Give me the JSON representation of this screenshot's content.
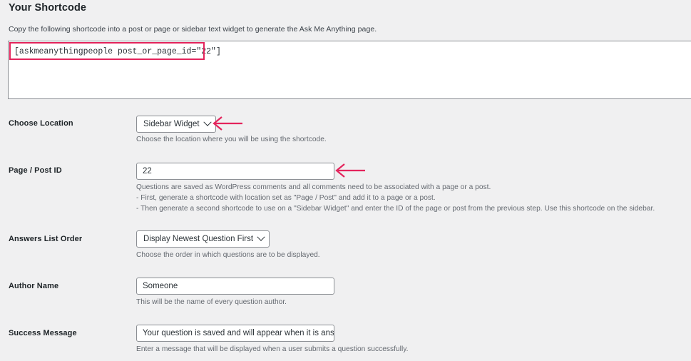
{
  "header": {
    "title": "Your Shortcode",
    "description": "Copy the following shortcode into a post or page or sidebar text widget to generate the Ask Me Anything page."
  },
  "shortcode": {
    "value": "[askmeanythingpeople post_or_page_id=\"22\"]",
    "highlight_color": "#e4245c"
  },
  "fields": {
    "location": {
      "label": "Choose Location",
      "control": "select",
      "value": "Sidebar Widget",
      "chevron_icon": "chevron-down-icon",
      "help": "Choose the location where you will be using the shortcode."
    },
    "page_post_id": {
      "label": "Page / Post ID",
      "control": "input",
      "value": "22",
      "help_lines": [
        "Questions are saved as WordPress comments and all comments need to be associated with a page or a post.",
        "- First, generate a shortcode with location set as \"Page / Post\" and add it to a page or a post.",
        "- Then generate a second shortcode to use on a \"Sidebar Widget\" and enter the ID of the page or post from the previous step. Use this shortcode on the sidebar."
      ]
    },
    "answers_order": {
      "label": "Answers List Order",
      "control": "select",
      "value": "Display Newest Question First",
      "chevron_icon": "chevron-down-icon",
      "help": "Choose the order in which questions are to be displayed."
    },
    "author_name": {
      "label": "Author Name",
      "control": "input",
      "value": "Someone",
      "help": "This will be the name of every question author."
    },
    "success_message": {
      "label": "Success Message",
      "control": "input",
      "value": "Your question is saved and will appear when it is answered.",
      "help": "Enter a message that will be displayed when a user submits a question successfully."
    }
  },
  "annotations": {
    "arrow_color": "#e4245c",
    "arrow_location": "arrow-pointing-to-location-select",
    "arrow_page_id": "arrow-pointing-to-page-post-id-input"
  }
}
